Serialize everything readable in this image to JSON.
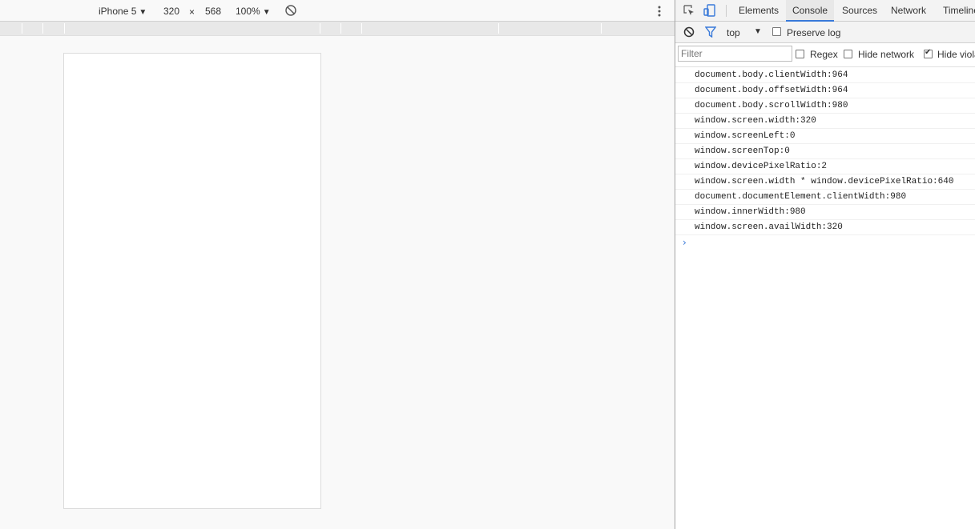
{
  "device_toolbar": {
    "device": "iPhone 5",
    "width": "320",
    "times": "×",
    "height": "568",
    "zoom": "100%",
    "caret": "▼",
    "rotate_icon": "rotate-icon",
    "more_icon": "vertical-ellipsis-icon"
  },
  "devtools": {
    "tabs": [
      {
        "label": "Elements",
        "active": false
      },
      {
        "label": "Console",
        "active": true
      },
      {
        "label": "Sources",
        "active": false
      },
      {
        "label": "Network",
        "active": false
      },
      {
        "label": "Timeline",
        "active": false
      }
    ],
    "accent": "#3879d9",
    "console_toolbar": {
      "context": "top",
      "caret": "▼",
      "preserve_log": "Preserve log",
      "preserve_checked": false
    },
    "filter_bar": {
      "placeholder": "Filter",
      "regex": "Regex",
      "regex_checked": false,
      "hide_network": "Hide network",
      "hide_network_checked": false,
      "hide_violations": "Hide violations",
      "hide_violations_checked": true
    },
    "console_messages": [
      "document.body.clientWidth:964",
      "document.body.offsetWidth:964",
      "document.body.scrollWidth:980",
      "window.screen.width:320",
      "window.screenLeft:0",
      "window.screenTop:0",
      "window.devicePixelRatio:2",
      "window.screen.width * window.devicePixelRatio:640",
      "document.documentElement.clientWidth:980",
      "window.innerWidth:980",
      "window.screen.availWidth:320"
    ],
    "prompt_symbol": "›"
  }
}
